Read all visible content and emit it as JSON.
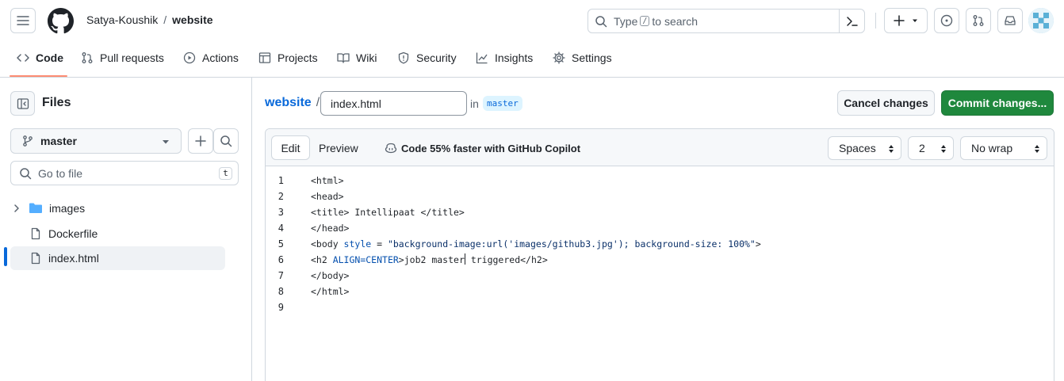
{
  "header": {
    "owner": "Satya-Koushik",
    "separator": "/",
    "repo": "website",
    "search_prefix": "Type",
    "search_key": "/",
    "search_suffix": "to search"
  },
  "repo_nav": {
    "items": [
      {
        "label": "Code",
        "icon": "code-icon"
      },
      {
        "label": "Pull requests",
        "icon": "git-pull-request-icon"
      },
      {
        "label": "Actions",
        "icon": "play-icon"
      },
      {
        "label": "Projects",
        "icon": "table-icon"
      },
      {
        "label": "Wiki",
        "icon": "book-icon"
      },
      {
        "label": "Security",
        "icon": "shield-icon"
      },
      {
        "label": "Insights",
        "icon": "graph-icon"
      },
      {
        "label": "Settings",
        "icon": "gear-icon"
      }
    ]
  },
  "sidebar": {
    "title": "Files",
    "branch": "master",
    "goto_placeholder": "Go to file",
    "goto_shortcut": "t",
    "tree": [
      {
        "name": "images",
        "type": "folder"
      },
      {
        "name": "Dockerfile",
        "type": "file"
      },
      {
        "name": "index.html",
        "type": "file",
        "selected": true
      }
    ]
  },
  "editor_header": {
    "repo_link": "website",
    "slash": "/",
    "filename": "index.html",
    "in_label": "in",
    "branch": "master",
    "cancel_label": "Cancel changes",
    "commit_label": "Commit changes..."
  },
  "editor": {
    "tab_edit": "Edit",
    "tab_preview": "Preview",
    "copilot_text": "Code 55% faster with GitHub Copilot",
    "indent_mode": "Spaces",
    "indent_size": "2",
    "wrap_mode": "No wrap",
    "line_numbers": [
      "1",
      "2",
      "3",
      "4",
      "5",
      "6",
      "7",
      "8",
      "9"
    ],
    "code": {
      "l1": "<html>",
      "l2": "<head>",
      "l3": "<title> Intellipaat </title>",
      "l4": "</head>",
      "l5_a": "<body ",
      "l5_b": "style",
      "l5_c": " = ",
      "l5_d": "\"background-image:url('images/github3.jpg'); background-size: 100%\"",
      "l5_e": ">",
      "l6_a": "<h2 ",
      "l6_b": "ALIGN=CENTER",
      "l6_c": ">job2 master",
      "l6_d": " triggered</h2>",
      "l7": "</body>",
      "l8": "</html>",
      "l9": ""
    }
  },
  "colors": {
    "accent": "#0969da",
    "commit_green": "#1f883d",
    "nav_underline": "#fd8c73"
  }
}
